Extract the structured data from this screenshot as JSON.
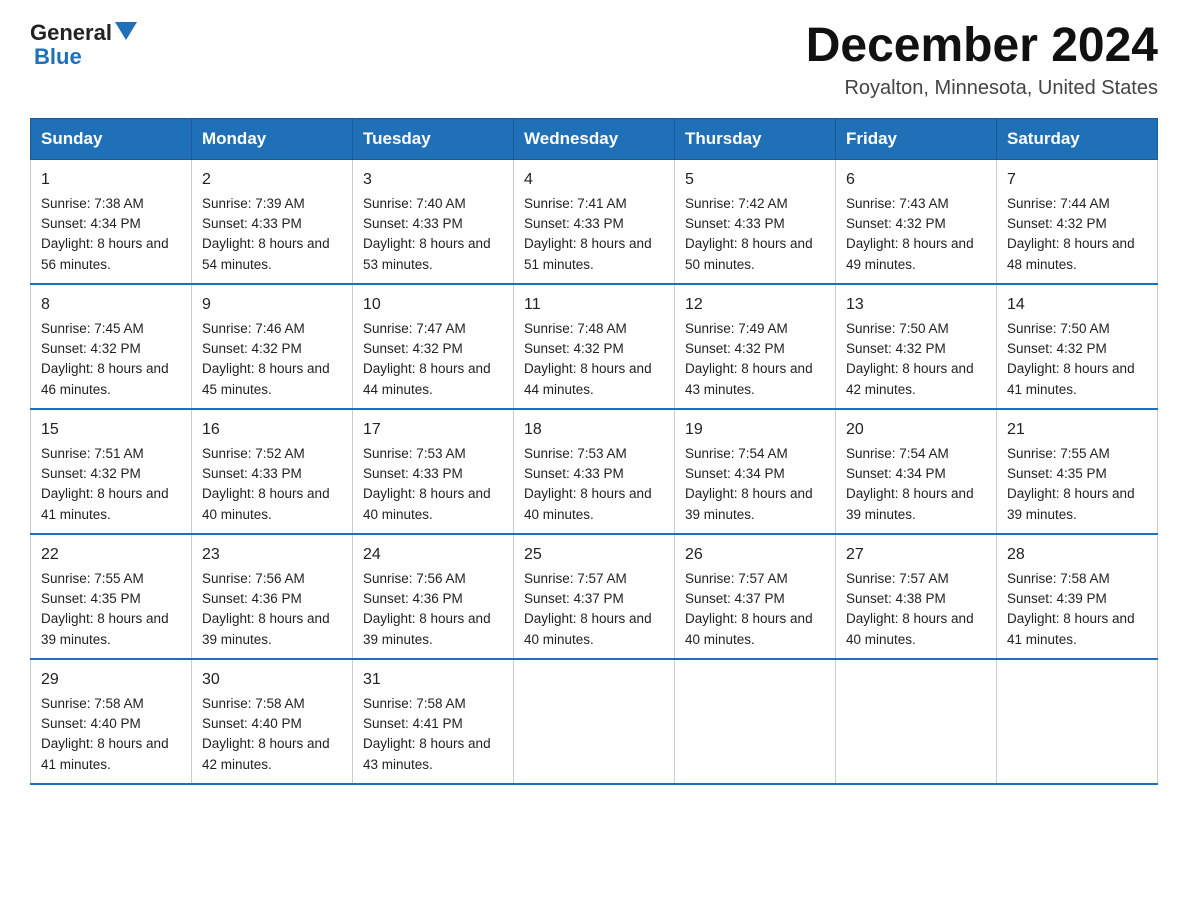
{
  "header": {
    "logo_general": "General",
    "logo_blue": "Blue",
    "month_title": "December 2024",
    "location": "Royalton, Minnesota, United States"
  },
  "days_of_week": [
    "Sunday",
    "Monday",
    "Tuesday",
    "Wednesday",
    "Thursday",
    "Friday",
    "Saturday"
  ],
  "weeks": [
    [
      {
        "day": 1,
        "sunrise": "7:38 AM",
        "sunset": "4:34 PM",
        "daylight": "8 hours and 56 minutes."
      },
      {
        "day": 2,
        "sunrise": "7:39 AM",
        "sunset": "4:33 PM",
        "daylight": "8 hours and 54 minutes."
      },
      {
        "day": 3,
        "sunrise": "7:40 AM",
        "sunset": "4:33 PM",
        "daylight": "8 hours and 53 minutes."
      },
      {
        "day": 4,
        "sunrise": "7:41 AM",
        "sunset": "4:33 PM",
        "daylight": "8 hours and 51 minutes."
      },
      {
        "day": 5,
        "sunrise": "7:42 AM",
        "sunset": "4:33 PM",
        "daylight": "8 hours and 50 minutes."
      },
      {
        "day": 6,
        "sunrise": "7:43 AM",
        "sunset": "4:32 PM",
        "daylight": "8 hours and 49 minutes."
      },
      {
        "day": 7,
        "sunrise": "7:44 AM",
        "sunset": "4:32 PM",
        "daylight": "8 hours and 48 minutes."
      }
    ],
    [
      {
        "day": 8,
        "sunrise": "7:45 AM",
        "sunset": "4:32 PM",
        "daylight": "8 hours and 46 minutes."
      },
      {
        "day": 9,
        "sunrise": "7:46 AM",
        "sunset": "4:32 PM",
        "daylight": "8 hours and 45 minutes."
      },
      {
        "day": 10,
        "sunrise": "7:47 AM",
        "sunset": "4:32 PM",
        "daylight": "8 hours and 44 minutes."
      },
      {
        "day": 11,
        "sunrise": "7:48 AM",
        "sunset": "4:32 PM",
        "daylight": "8 hours and 44 minutes."
      },
      {
        "day": 12,
        "sunrise": "7:49 AM",
        "sunset": "4:32 PM",
        "daylight": "8 hours and 43 minutes."
      },
      {
        "day": 13,
        "sunrise": "7:50 AM",
        "sunset": "4:32 PM",
        "daylight": "8 hours and 42 minutes."
      },
      {
        "day": 14,
        "sunrise": "7:50 AM",
        "sunset": "4:32 PM",
        "daylight": "8 hours and 41 minutes."
      }
    ],
    [
      {
        "day": 15,
        "sunrise": "7:51 AM",
        "sunset": "4:32 PM",
        "daylight": "8 hours and 41 minutes."
      },
      {
        "day": 16,
        "sunrise": "7:52 AM",
        "sunset": "4:33 PM",
        "daylight": "8 hours and 40 minutes."
      },
      {
        "day": 17,
        "sunrise": "7:53 AM",
        "sunset": "4:33 PM",
        "daylight": "8 hours and 40 minutes."
      },
      {
        "day": 18,
        "sunrise": "7:53 AM",
        "sunset": "4:33 PM",
        "daylight": "8 hours and 40 minutes."
      },
      {
        "day": 19,
        "sunrise": "7:54 AM",
        "sunset": "4:34 PM",
        "daylight": "8 hours and 39 minutes."
      },
      {
        "day": 20,
        "sunrise": "7:54 AM",
        "sunset": "4:34 PM",
        "daylight": "8 hours and 39 minutes."
      },
      {
        "day": 21,
        "sunrise": "7:55 AM",
        "sunset": "4:35 PM",
        "daylight": "8 hours and 39 minutes."
      }
    ],
    [
      {
        "day": 22,
        "sunrise": "7:55 AM",
        "sunset": "4:35 PM",
        "daylight": "8 hours and 39 minutes."
      },
      {
        "day": 23,
        "sunrise": "7:56 AM",
        "sunset": "4:36 PM",
        "daylight": "8 hours and 39 minutes."
      },
      {
        "day": 24,
        "sunrise": "7:56 AM",
        "sunset": "4:36 PM",
        "daylight": "8 hours and 39 minutes."
      },
      {
        "day": 25,
        "sunrise": "7:57 AM",
        "sunset": "4:37 PM",
        "daylight": "8 hours and 40 minutes."
      },
      {
        "day": 26,
        "sunrise": "7:57 AM",
        "sunset": "4:37 PM",
        "daylight": "8 hours and 40 minutes."
      },
      {
        "day": 27,
        "sunrise": "7:57 AM",
        "sunset": "4:38 PM",
        "daylight": "8 hours and 40 minutes."
      },
      {
        "day": 28,
        "sunrise": "7:58 AM",
        "sunset": "4:39 PM",
        "daylight": "8 hours and 41 minutes."
      }
    ],
    [
      {
        "day": 29,
        "sunrise": "7:58 AM",
        "sunset": "4:40 PM",
        "daylight": "8 hours and 41 minutes."
      },
      {
        "day": 30,
        "sunrise": "7:58 AM",
        "sunset": "4:40 PM",
        "daylight": "8 hours and 42 minutes."
      },
      {
        "day": 31,
        "sunrise": "7:58 AM",
        "sunset": "4:41 PM",
        "daylight": "8 hours and 43 minutes."
      },
      null,
      null,
      null,
      null
    ]
  ]
}
